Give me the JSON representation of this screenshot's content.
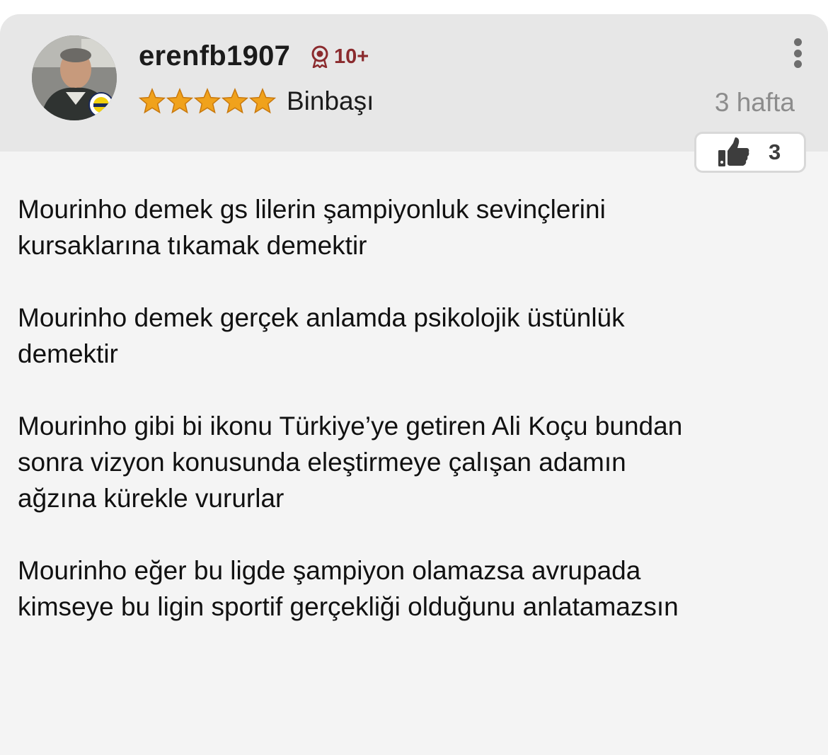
{
  "comment": {
    "username": "erenfb1907",
    "badge_text": "10+",
    "rank": "Binbaşı",
    "star_rating": 5,
    "time_ago": "3 hafta",
    "like_count": "3",
    "paragraphs": [
      "Mourinho demek gs lilerin şampiyonluk sevinçlerini\nkursaklarına tıkamak demektir",
      "Mourinho demek gerçek anlamda psikolojik üstünlük\ndemektir",
      "Mourinho gibi bi ikonu Türkiye’ye getiren Ali Koçu bundan\nsonra vizyon konusunda eleştirmeye çalışan adamın\nağzına kürekle vururlar",
      "Mourinho eğer bu ligde şampiyon olamazsa avrupada\nkimseye bu ligin sportif gerçekliği olduğunu anlatamazsın"
    ]
  },
  "icons": {
    "avatar": "user-avatar-photo",
    "badge": "medal-icon",
    "star": "star-icon",
    "more": "more-vertical-icon",
    "like": "thumbs-up-icon"
  },
  "colors": {
    "header_bg": "#e7e7e7",
    "card_bg": "#f4f4f4",
    "badge": "#8b2b2e",
    "star": "#f0a21c",
    "time": "#8c8c8c"
  }
}
